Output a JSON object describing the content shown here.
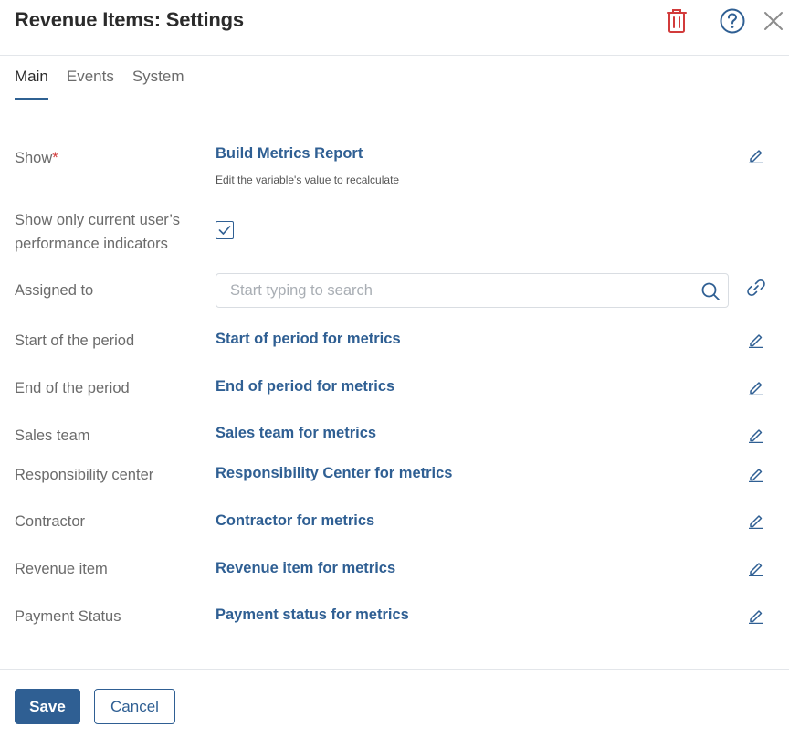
{
  "header": {
    "title": "Revenue Items: Settings"
  },
  "tabs": [
    {
      "label": "Main",
      "active": true
    },
    {
      "label": "Events",
      "active": false
    },
    {
      "label": "System",
      "active": false
    }
  ],
  "form": {
    "show": {
      "label": "Show",
      "required_mark": "*",
      "value": "Build Metrics Report",
      "hint": "Edit the variable's value to recalculate"
    },
    "only_current_user": {
      "label_line1": "Show only current user’s",
      "label_line2": "performance indicators",
      "checked": true
    },
    "assigned_to": {
      "label": "Assigned to",
      "placeholder": "Start typing to search",
      "value": ""
    },
    "fields": [
      {
        "label": "Start of the period",
        "value": "Start of period for metrics"
      },
      {
        "label": "End of the period",
        "value": "End of period for metrics"
      },
      {
        "label": "Sales team",
        "value": "Sales team for metrics"
      },
      {
        "label": "Responsibility center",
        "value": "Responsibility Center for metrics"
      },
      {
        "label": "Contractor",
        "value": "Contractor for metrics"
      },
      {
        "label": "Revenue item",
        "value": "Revenue item for metrics"
      },
      {
        "label": "Payment Status",
        "value": "Payment status for metrics"
      }
    ]
  },
  "footer": {
    "save_label": "Save",
    "cancel_label": "Cancel"
  },
  "colors": {
    "accent": "#2f5f93",
    "danger": "#d23b3b",
    "label": "#6b6b6b"
  },
  "icons": [
    "trash-icon",
    "help-icon",
    "close-icon",
    "pencil-icon",
    "search-icon",
    "link-icon",
    "checkmark-icon"
  ]
}
